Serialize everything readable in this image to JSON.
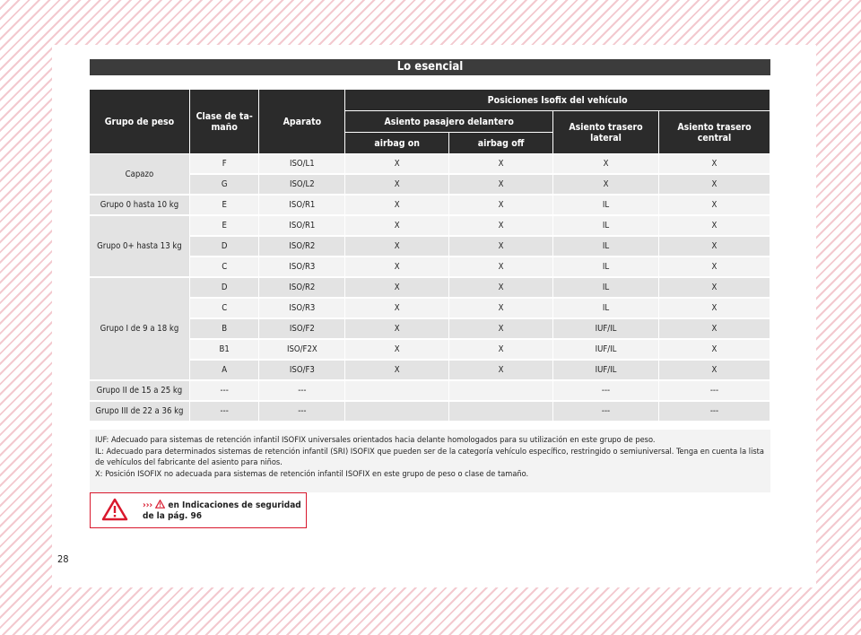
{
  "header": {
    "title": "Lo esencial"
  },
  "table": {
    "col_weight_group": "Grupo de peso",
    "col_size_class": "Clase de ta-maño",
    "col_device": "Aparato",
    "col_positions": "Posiciones Isofix del vehículo",
    "col_front_passenger": "Asiento pasajero delantero",
    "col_airbag_on": "airbag on",
    "col_airbag_off": "airbag off",
    "col_rear_side": "Asiento trasero lateral",
    "col_rear_center": "Asiento trasero central",
    "groups": [
      {
        "label": "Capazo",
        "rows": [
          [
            "F",
            "ISO/L1",
            "X",
            "X",
            "X",
            "X"
          ],
          [
            "G",
            "ISO/L2",
            "X",
            "X",
            "X",
            "X"
          ]
        ]
      },
      {
        "label": "Grupo 0 hasta 10 kg",
        "rows": [
          [
            "E",
            "ISO/R1",
            "X",
            "X",
            "IL",
            "X"
          ]
        ]
      },
      {
        "label": "Grupo 0+ hasta 13 kg",
        "rows": [
          [
            "E",
            "ISO/R1",
            "X",
            "X",
            "IL",
            "X"
          ],
          [
            "D",
            "ISO/R2",
            "X",
            "X",
            "IL",
            "X"
          ],
          [
            "C",
            "ISO/R3",
            "X",
            "X",
            "IL",
            "X"
          ]
        ]
      },
      {
        "label": "Grupo I de 9 a 18 kg",
        "rows": [
          [
            "D",
            "ISO/R2",
            "X",
            "X",
            "IL",
            "X"
          ],
          [
            "C",
            "ISO/R3",
            "X",
            "X",
            "IL",
            "X"
          ],
          [
            "B",
            "ISO/F2",
            "X",
            "X",
            "IUF/IL",
            "X"
          ],
          [
            "B1",
            "ISO/F2X",
            "X",
            "X",
            "IUF/IL",
            "X"
          ],
          [
            "A",
            "ISO/F3",
            "X",
            "X",
            "IUF/IL",
            "X"
          ]
        ]
      },
      {
        "label": "Grupo II de 15 a 25 kg",
        "rows": [
          [
            "---",
            "---",
            "",
            "",
            "---",
            "---"
          ]
        ]
      },
      {
        "label": "Grupo III de 22 a 36 kg",
        "rows": [
          [
            "---",
            "---",
            "",
            "",
            "---",
            "---"
          ]
        ]
      }
    ]
  },
  "notes": {
    "iuf": "IUF: Adecuado para sistemas de retención infantil ISOFIX universales orientados hacia delante homologados para su utilización en este grupo de peso.",
    "il": "IL: Adecuado para determinados sistemas de retención infantil (SRI) ISOFIX que pueden ser de la categoría vehículo específico, restringido o semiuniversal. Tenga en cuenta la lista de vehículos del fabricante del asiento para niños.",
    "x": "X: Posición ISOFIX no adecuada para sistemas de retención infantil ISOFIX en este grupo de peso o clase de tamaño."
  },
  "warning": {
    "arrows": "›››",
    "text": " en Indicaciones de seguridad de la pág. 96"
  },
  "page_number": "28",
  "colors": {
    "accent": "#d9182d",
    "header": "#2b2b2b",
    "hatch": "#f3c9cf"
  }
}
